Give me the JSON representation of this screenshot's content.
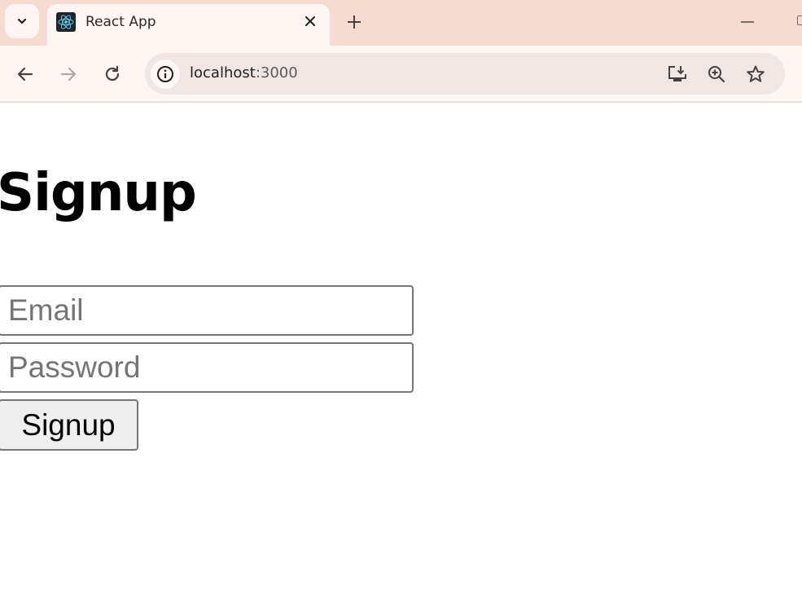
{
  "browser": {
    "tab": {
      "title": "React App",
      "favicon": "react-logo-icon"
    },
    "address_bar": {
      "host": "localhost",
      "port": ":3000"
    },
    "icons": {
      "tab_search": "chevron-down-icon",
      "tab_close": "close-icon",
      "new_tab": "plus-icon",
      "back": "arrow-left-icon",
      "forward": "arrow-right-icon",
      "reload": "reload-icon",
      "site_info": "info-icon",
      "install": "install-app-icon",
      "zoom": "zoom-in-icon",
      "bookmark": "star-icon"
    }
  },
  "page": {
    "heading": "Signup",
    "form": {
      "email": {
        "value": "",
        "placeholder": "Email"
      },
      "password": {
        "value": "",
        "placeholder": "Password"
      },
      "submit_label": "Signup"
    }
  }
}
